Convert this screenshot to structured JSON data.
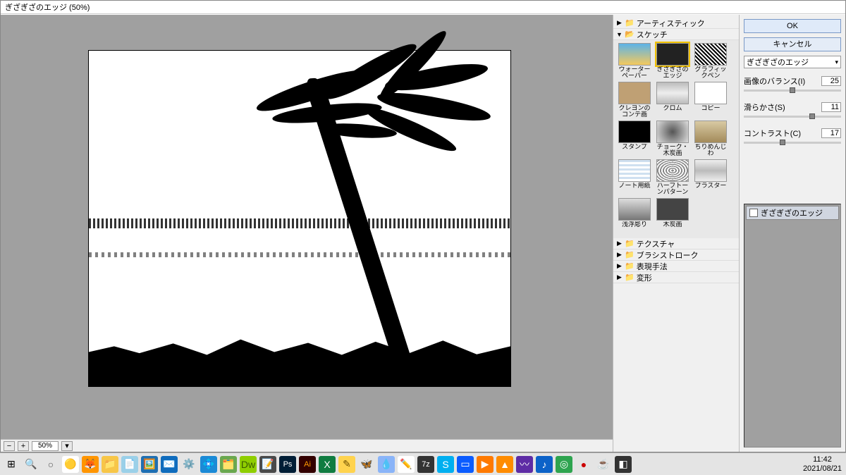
{
  "window": {
    "title": "ぎざぎざのエッジ (50%)"
  },
  "zoombar": {
    "zoom": "50%"
  },
  "categories": {
    "artistic": {
      "label": "アーティスティック",
      "expanded": false
    },
    "sketch": {
      "label": "スケッチ",
      "expanded": true
    },
    "texture": {
      "label": "テクスチャ",
      "expanded": false
    },
    "brush": {
      "label": "ブラシストローク",
      "expanded": false
    },
    "style": {
      "label": "表現手法",
      "expanded": false
    },
    "distort": {
      "label": "変形",
      "expanded": false
    }
  },
  "sketch_thumbs": [
    {
      "label": "ウォーターペーパー"
    },
    {
      "label": "ぎざぎざのエッジ",
      "selected": true
    },
    {
      "label": "グラフィックペン"
    },
    {
      "label": "クレヨンのコンテ画"
    },
    {
      "label": "クロム"
    },
    {
      "label": "コピー"
    },
    {
      "label": "スタンプ"
    },
    {
      "label": "チョーク・木炭画"
    },
    {
      "label": "ちりめんじわ"
    },
    {
      "label": "ノート用紙"
    },
    {
      "label": "ハーフトーンパターン"
    },
    {
      "label": "プラスター"
    },
    {
      "label": "浅浮彫り"
    },
    {
      "label": "木炭画"
    }
  ],
  "buttons": {
    "ok": "OK",
    "cancel": "キャンセル"
  },
  "filter_dropdown": "ぎざぎざのエッジ",
  "sliders": {
    "balance": {
      "label": "画像のバランス(I)",
      "value": "25",
      "pct": 50
    },
    "smooth": {
      "label": "滑らかさ(S)",
      "value": "11",
      "pct": 70
    },
    "contrast": {
      "label": "コントラスト(C)",
      "value": "17",
      "pct": 40
    }
  },
  "layer_filter": "ぎざぎざのエッジ",
  "taskbar": {
    "time": "11:42",
    "date": "2021/08/21"
  }
}
